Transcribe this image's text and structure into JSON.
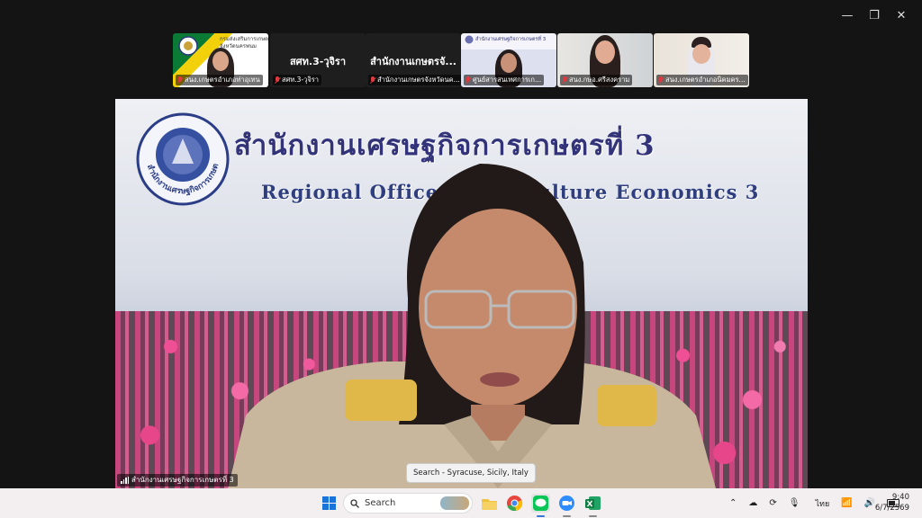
{
  "window_controls": {
    "minimize": "—",
    "restore": "❐",
    "close": "✕"
  },
  "participants": [
    {
      "name": "สนง.เกษตรอำเภอท่าอุเทน",
      "logo_text_line1": "กรมส่งเสริมการเกษตรอำเภอ",
      "logo_text_line2": "จังหวัดนครพนม"
    },
    {
      "name": "สศท.3-วุจิรา",
      "label": "สศท.3-วุจิรา"
    },
    {
      "name": "สำนักงานเกษตรจังหวัดนค...",
      "label": "สำนักงานเกษตรจั..."
    },
    {
      "name": "ศูนย์สารสนเทศการเก...",
      "banner": "สำนักงานเศรษฐกิจการเกษตรที่ 3"
    },
    {
      "name": "สนง.กษอ.ศรีสงคราม"
    },
    {
      "name": "สนง.เกษตรอำเภอนิคมคร..."
    }
  ],
  "main_video": {
    "title_th": "สำนักงานเศรษฐกิจการเกษตรที่ 3",
    "title_en": "Regional Office of Agriculture Economics 3",
    "logo_ring_text": "สำนักงานเศรษฐกิจการเกษตร",
    "speaker_name": "สำนักงานเศรษฐกิจการเกษตรที่ 3"
  },
  "tooltip": "Search - Syracuse, Sicily, Italy",
  "taskbar": {
    "search_placeholder": "Search",
    "lang": "ไทย",
    "time": "9:40",
    "date": "6/7/2569"
  },
  "colors": {
    "taskbar": "#f3eeef",
    "title": "#33337a",
    "mic_muted": "#e0393e"
  }
}
